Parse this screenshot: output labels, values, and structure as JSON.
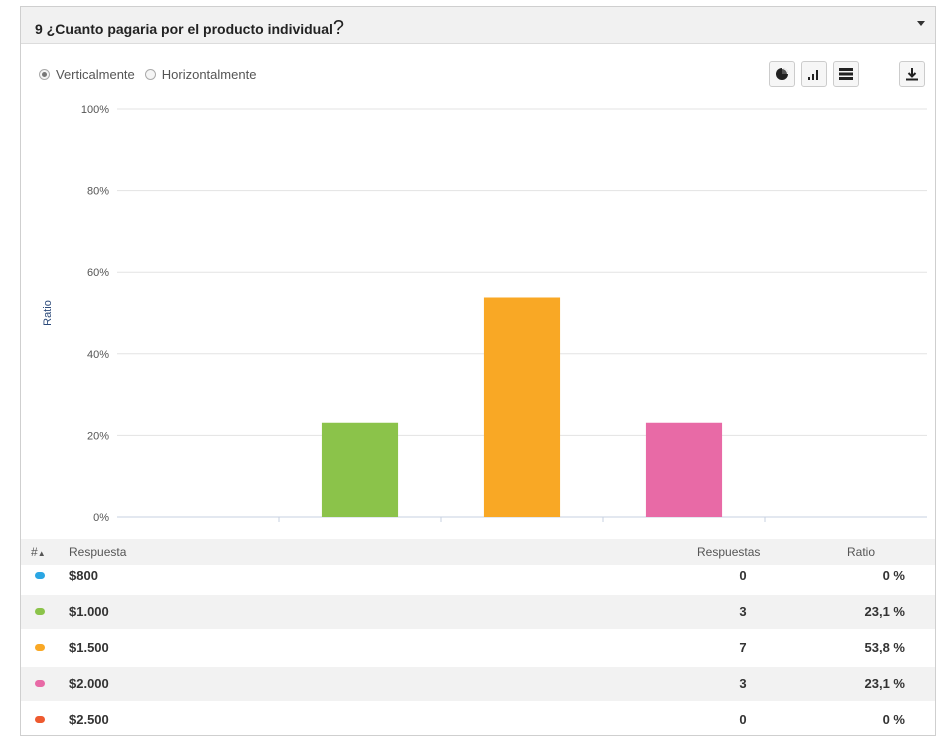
{
  "question": {
    "title": "9 ¿Cuanto pagaria por el producto individual",
    "qmark": "?"
  },
  "orientation": {
    "vertical_label": "Verticalmente",
    "horizontal_label": "Horizontalmente",
    "selected": "vertical"
  },
  "toolbar": {
    "icons": [
      "pie-chart-icon",
      "bar-chart-icon",
      "table-icon",
      "download-icon"
    ]
  },
  "chart_data": {
    "type": "bar",
    "ylabel": "Ratio",
    "ylim": [
      0,
      100
    ],
    "yticks": [
      "0%",
      "20%",
      "40%",
      "60%",
      "80%",
      "100%"
    ],
    "categories": [
      "$800",
      "$1.000",
      "$1.500",
      "$2.000",
      "$2.500"
    ],
    "values": [
      0,
      23.1,
      53.8,
      23.1,
      0
    ],
    "colors": [
      "#2ba6e3",
      "#8bc34a",
      "#f9a825",
      "#e86aa6",
      "#ee5a2f"
    ],
    "grid": true
  },
  "table": {
    "headers": {
      "index": "#",
      "answer": "Respuesta",
      "responses": "Respuestas",
      "ratio": "Ratio"
    },
    "rows": [
      {
        "answer": "$800",
        "responses": "0",
        "ratio": "0 %"
      },
      {
        "answer": "$1.000",
        "responses": "3",
        "ratio": "23,1 %"
      },
      {
        "answer": "$1.500",
        "responses": "7",
        "ratio": "53,8 %"
      },
      {
        "answer": "$2.000",
        "responses": "3",
        "ratio": "23,1 %"
      },
      {
        "answer": "$2.500",
        "responses": "0",
        "ratio": "0 %"
      }
    ]
  }
}
